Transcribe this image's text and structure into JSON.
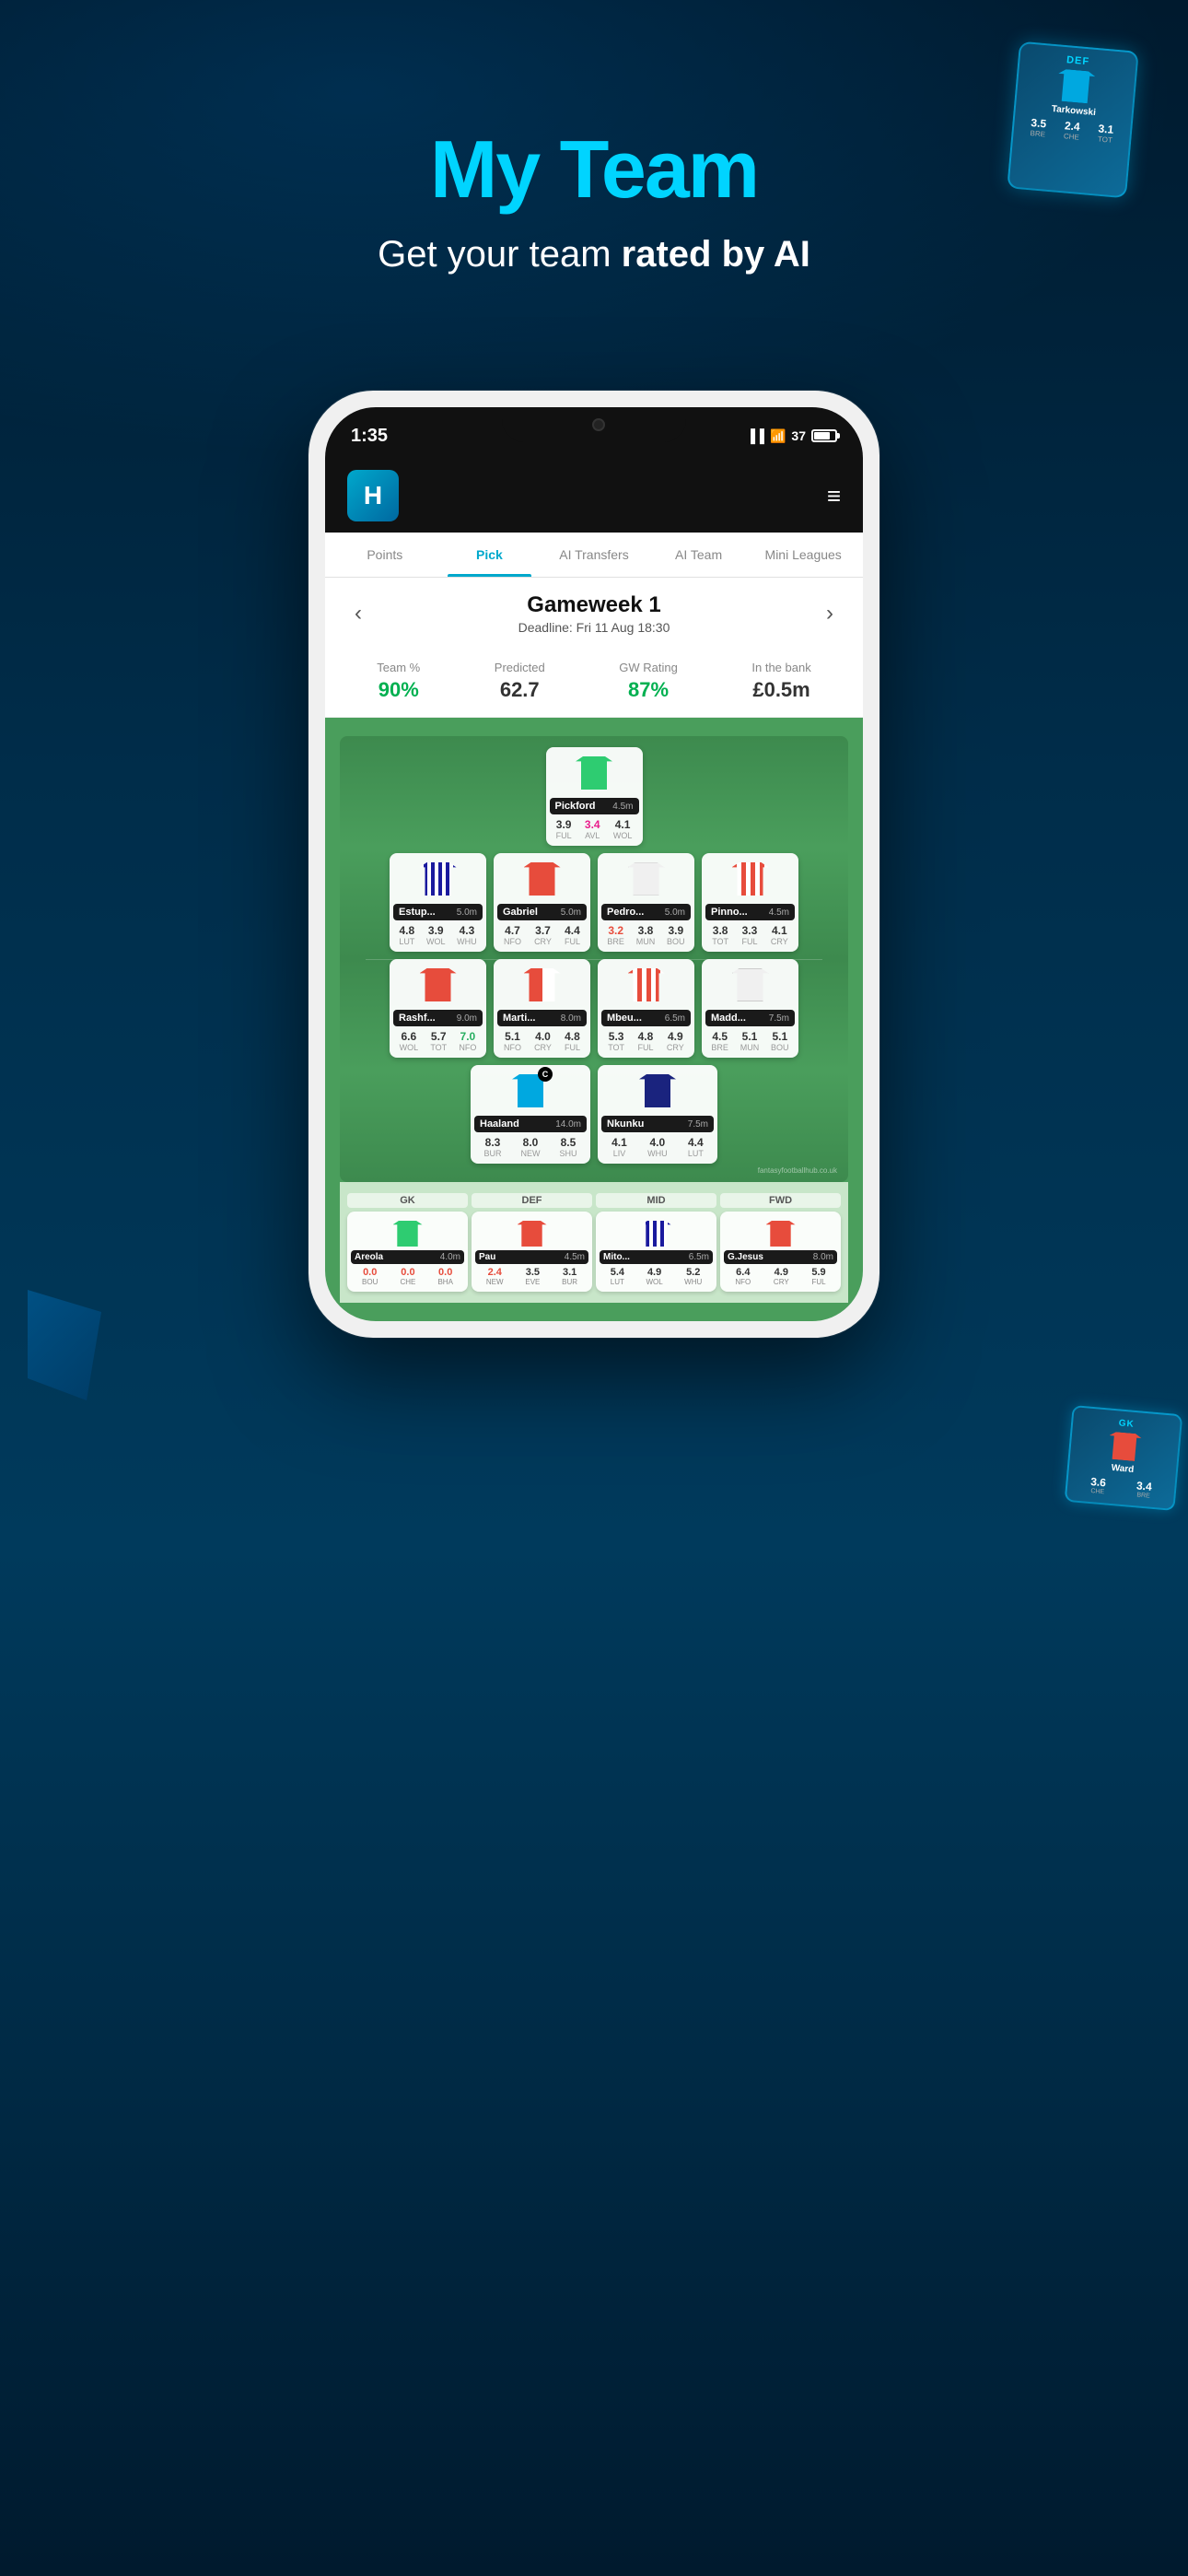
{
  "app": {
    "title": "My Team",
    "subtitle_normal": "Get your team ",
    "subtitle_bold": "rated by AI",
    "status_time": "1:35",
    "battery_level": "37"
  },
  "nav": {
    "tabs": [
      {
        "label": "Points",
        "active": false
      },
      {
        "label": "Pick",
        "active": true
      },
      {
        "label": "AI Transfers",
        "active": false
      },
      {
        "label": "AI Team",
        "active": false
      },
      {
        "label": "Mini Leagues",
        "active": false
      }
    ]
  },
  "gameweek": {
    "title": "Gameweek 1",
    "deadline": "Deadline: Fri 11 Aug 18:30",
    "stats": [
      {
        "label": "Team %",
        "value": "90%",
        "type": "green"
      },
      {
        "label": "Predicted",
        "value": "62.7",
        "type": "grey"
      },
      {
        "label": "GW Rating",
        "value": "87%",
        "type": "green"
      },
      {
        "label": "In the bank",
        "value": "£0.5m",
        "type": "grey"
      }
    ]
  },
  "pitch": {
    "goalkeeper": {
      "name": "Pickford",
      "price": "4.5m",
      "ratings": [
        {
          "val": "3.9",
          "team": "FUL",
          "color": "normal"
        },
        {
          "val": "3.4",
          "team": "AVL",
          "color": "pink"
        },
        {
          "val": "4.1",
          "team": "WOL",
          "color": "normal"
        }
      ]
    },
    "defenders": [
      {
        "name": "Estup...",
        "price": "5.0m",
        "ratings": [
          {
            "val": "4.8",
            "team": "LUT",
            "color": "normal"
          },
          {
            "val": "3.9",
            "team": "WOL",
            "color": "normal"
          },
          {
            "val": "4.3",
            "team": "WHU",
            "color": "normal"
          }
        ]
      },
      {
        "name": "Gabriel",
        "price": "5.0m",
        "ratings": [
          {
            "val": "4.7",
            "team": "NFO",
            "color": "normal"
          },
          {
            "val": "3.7",
            "team": "CRY",
            "color": "normal"
          },
          {
            "val": "4.4",
            "team": "FUL",
            "color": "normal"
          }
        ]
      },
      {
        "name": "Pedro...",
        "price": "5.0m",
        "ratings": [
          {
            "val": "3.2",
            "team": "BRE",
            "color": "red"
          },
          {
            "val": "3.8",
            "team": "MUN",
            "color": "normal"
          },
          {
            "val": "3.9",
            "team": "BOU",
            "color": "normal"
          }
        ]
      },
      {
        "name": "Pinno...",
        "price": "4.5m",
        "ratings": [
          {
            "val": "3.8",
            "team": "TOT",
            "color": "normal"
          },
          {
            "val": "3.3",
            "team": "FUL",
            "color": "normal"
          },
          {
            "val": "4.1",
            "team": "CRY",
            "color": "normal"
          }
        ]
      }
    ],
    "midfielders": [
      {
        "name": "Rashf...",
        "price": "9.0m",
        "ratings": [
          {
            "val": "6.6",
            "team": "WOL",
            "color": "normal"
          },
          {
            "val": "5.7",
            "team": "TOT",
            "color": "normal"
          },
          {
            "val": "7.0",
            "team": "NFO",
            "color": "green"
          }
        ]
      },
      {
        "name": "Marti...",
        "price": "8.0m",
        "ratings": [
          {
            "val": "5.1",
            "team": "NFO",
            "color": "normal"
          },
          {
            "val": "4.0",
            "team": "CRY",
            "color": "normal"
          },
          {
            "val": "4.8",
            "team": "FUL",
            "color": "normal"
          }
        ]
      },
      {
        "name": "Mbeu...",
        "price": "6.5m",
        "ratings": [
          {
            "val": "5.3",
            "team": "TOT",
            "color": "normal"
          },
          {
            "val": "4.8",
            "team": "FUL",
            "color": "normal"
          },
          {
            "val": "4.9",
            "team": "CRY",
            "color": "normal"
          }
        ]
      },
      {
        "name": "Madd...",
        "price": "7.5m",
        "ratings": [
          {
            "val": "4.5",
            "team": "BRE",
            "color": "normal"
          },
          {
            "val": "5.1",
            "team": "MUN",
            "color": "normal"
          },
          {
            "val": "5.1",
            "team": "BOU",
            "color": "normal"
          }
        ]
      }
    ],
    "forwards": [
      {
        "name": "Haaland",
        "price": "14.0m",
        "is_captain": true,
        "ratings": [
          {
            "val": "8.3",
            "team": "BUR",
            "color": "normal"
          },
          {
            "val": "8.0",
            "team": "NEW",
            "color": "normal"
          },
          {
            "val": "8.5",
            "team": "SHU",
            "color": "normal"
          }
        ]
      },
      {
        "name": "Nkunku",
        "price": "7.5m",
        "ratings": [
          {
            "val": "4.1",
            "team": "LIV",
            "color": "normal"
          },
          {
            "val": "4.0",
            "team": "WHU",
            "color": "normal"
          },
          {
            "val": "4.4",
            "team": "LUT",
            "color": "normal"
          }
        ]
      }
    ]
  },
  "bench": {
    "players": [
      {
        "position": "GK",
        "name": "Areola",
        "price": "4.0m",
        "ratings": [
          {
            "val": "0.0",
            "team": "BOU",
            "color": "red"
          },
          {
            "val": "0.0",
            "team": "CHE",
            "color": "red"
          },
          {
            "val": "0.0",
            "team": "BHA",
            "color": "red"
          }
        ]
      },
      {
        "position": "DEF",
        "name": "Pau",
        "price": "4.5m",
        "ratings": [
          {
            "val": "2.4",
            "team": "NEW",
            "color": "red"
          },
          {
            "val": "3.5",
            "team": "EVE",
            "color": "normal"
          },
          {
            "val": "3.1",
            "team": "BUR",
            "color": "normal"
          }
        ]
      },
      {
        "position": "MID",
        "name": "Mito...",
        "price": "6.5m",
        "ratings": [
          {
            "val": "5.4",
            "team": "LUT",
            "color": "normal"
          },
          {
            "val": "4.9",
            "team": "WOL",
            "color": "normal"
          },
          {
            "val": "5.2",
            "team": "WHU",
            "color": "normal"
          }
        ]
      },
      {
        "position": "FWD",
        "name": "G.Jesus",
        "price": "8.0m",
        "ratings": [
          {
            "val": "6.4",
            "team": "NFO",
            "color": "normal"
          },
          {
            "val": "4.9",
            "team": "CRY",
            "color": "normal"
          },
          {
            "val": "5.9",
            "team": "FUL",
            "color": "normal"
          }
        ]
      }
    ]
  },
  "top_card": {
    "position": "DEF",
    "name": "Tarkowski",
    "stats": [
      {
        "val": "3.5",
        "team": "BRE"
      },
      {
        "val": "2.4",
        "team": "CHE"
      },
      {
        "val": "3.1",
        "team": "TOT"
      }
    ]
  },
  "right_card": {
    "position": "GK",
    "name": "Ward",
    "stats": [
      {
        "val": "3.6",
        "team": "CHE"
      },
      {
        "val": "3.4",
        "team": "BRE"
      }
    ]
  }
}
